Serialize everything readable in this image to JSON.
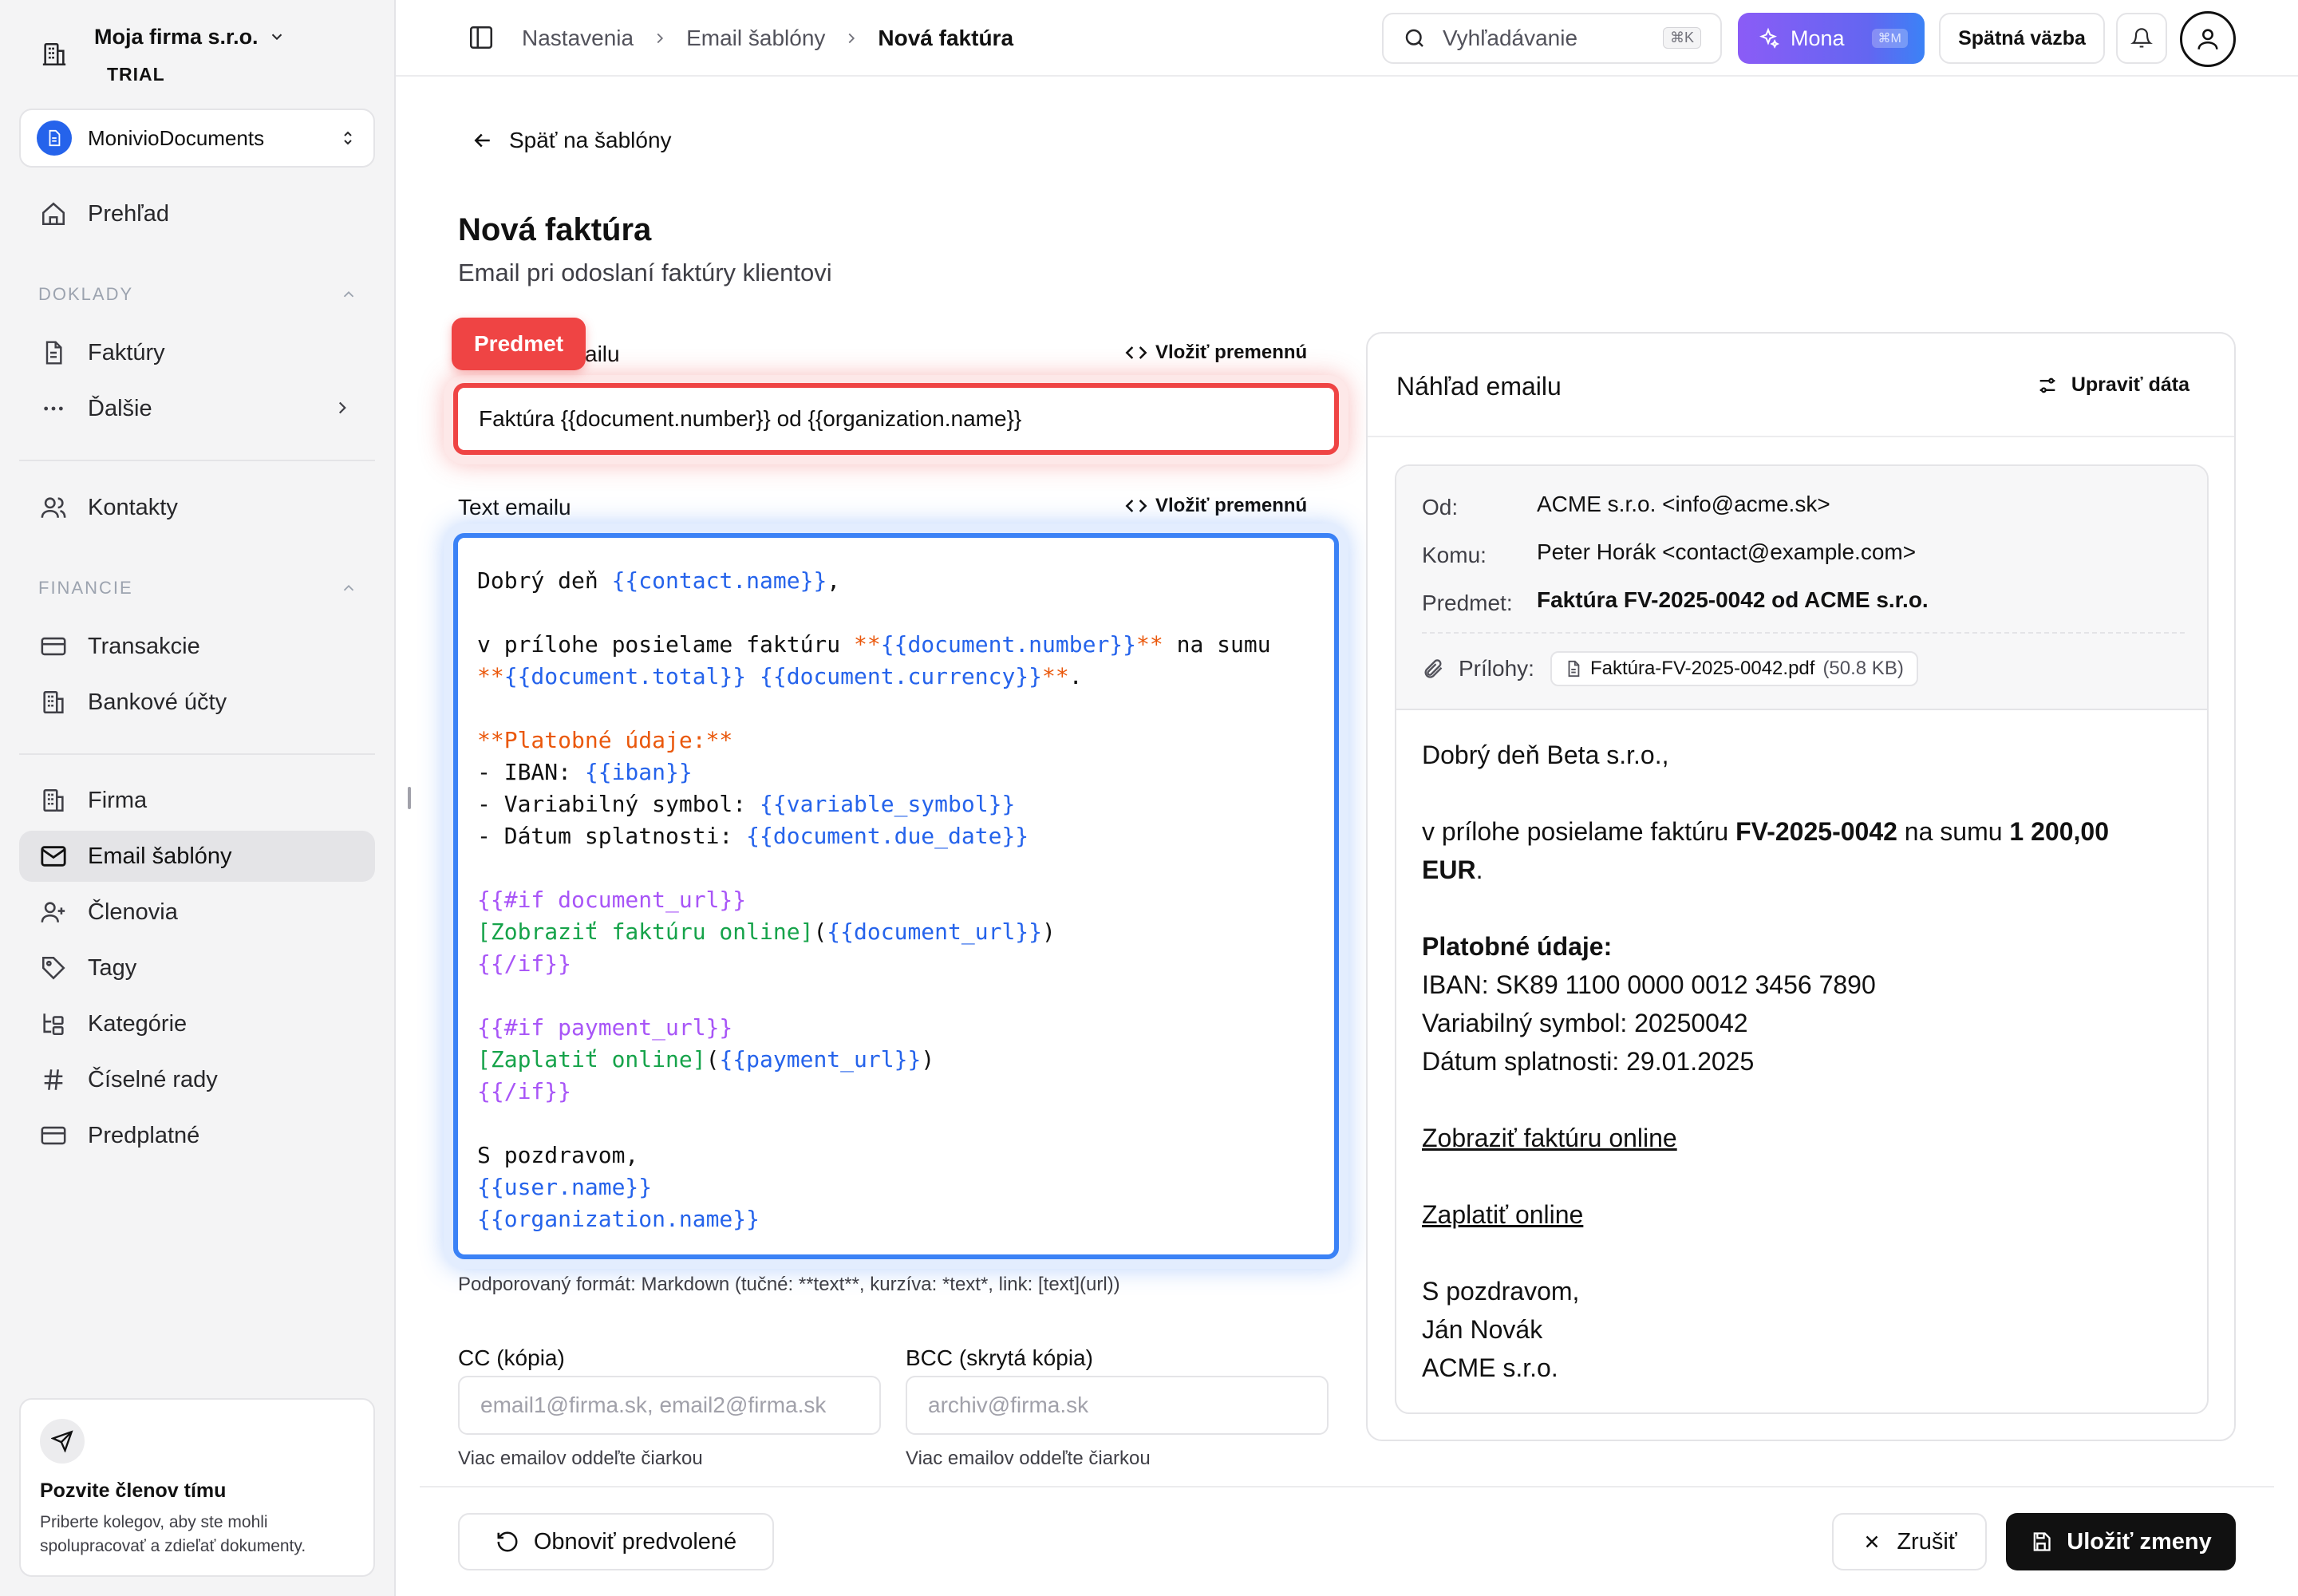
{
  "sidebar": {
    "org_name": "Moja firma s.r.o.",
    "org_badge": "TRIAL",
    "workspace": "MonivioDocuments",
    "items": {
      "overview": "Prehľad",
      "invoices": "Faktúry",
      "more": "Ďalšie",
      "contacts": "Kontakty",
      "transactions": "Transakcie",
      "bank_accounts": "Bankové účty",
      "company": "Firma",
      "email_templates": "Email šablóny",
      "members": "Členovia",
      "tags": "Tagy",
      "categories": "Kategórie",
      "number_series": "Číselné rady",
      "subscription": "Predplatné"
    },
    "sections": {
      "documents": "DOKLADY",
      "finance": "FINANCIE"
    },
    "invite": {
      "title": "Pozvite členov tímu",
      "text_line1": "Priberte kolegov, aby ste mohli",
      "text_line2": "spolupracovať a zdieľať dokumenty."
    }
  },
  "header": {
    "breadcrumbs": [
      "Nastavenia",
      "Email šablóny",
      "Nová faktúra"
    ],
    "search_placeholder": "Vyhľadávanie",
    "search_shortcut": "⌘K",
    "mona_label": "Mona",
    "mona_shortcut": "⌘M",
    "feedback_label": "Spätná väzba"
  },
  "main": {
    "back_label": "Späť na šablóny",
    "title": "Nová faktúra",
    "subtitle": "Email pri odoslaní faktúry klientovi",
    "subject": {
      "tag": "Predmet",
      "label_visible": "ailu",
      "insert_variable": "Vložiť premennú",
      "value": "Faktúra {{document.number}} od {{organization.name}}"
    },
    "body": {
      "label": "Text emailu",
      "insert_variable": "Vložiť premennú",
      "hint": "Podporovaný formát: Markdown (tučné: **text**, kurzíva: *text*, link: [text](url))"
    },
    "cc": {
      "label": "CC (kópia)",
      "placeholder": "email1@firma.sk, email2@firma.sk",
      "hint": "Viac emailov oddeľte čiarkou"
    },
    "bcc": {
      "label": "BCC (skrytá kópia)",
      "placeholder": "archiv@firma.sk",
      "hint": "Viac emailov oddeľte čiarkou"
    }
  },
  "footer": {
    "reset_label": "Obnoviť predvolené",
    "cancel_label": "Zrušiť",
    "save_label": "Uložiť zmeny"
  },
  "preview": {
    "title": "Náhľad emailu",
    "edit_data_label": "Upraviť dáta",
    "from_label": "Od:",
    "from_value": "ACME s.r.o. <info@acme.sk>",
    "to_label": "Komu:",
    "to_value": "Peter Horák <contact@example.com>",
    "subject_label": "Predmet:",
    "subject_value": "Faktúra FV-2025-0042 od ACME s.r.o.",
    "attachments_label": "Prílohy:",
    "attachment_name": "Faktúra-FV-2025-0042.pdf",
    "attachment_size": "(50.8 KB)",
    "greeting": "Dobrý deň Beta s.r.o.,",
    "line1_pre": "v prílohe posielame faktúru ",
    "line1_number": "FV-2025-0042",
    "line1_mid": " na sumu ",
    "line1_amount": "1 200,00",
    "line1_currency": "EUR",
    "line1_end": ".",
    "payment_heading": "Platobné údaje:",
    "iban": "IBAN: SK89 1100 0000 0012 3456 7890",
    "variable_symbol": "Variabilný symbol: 20250042",
    "due_date": "Dátum splatnosti: 29.01.2025",
    "view_online": "Zobraziť faktúru online",
    "pay_online": "Zaplatiť online",
    "closing": "S pozdravom,",
    "signature_name": "Ján Novák",
    "signature_org": "ACME s.r.o."
  },
  "colors": {
    "subject_highlight": "#ef4444",
    "body_highlight": "#3b82f6",
    "variable": "#2563eb",
    "bold_marker": "#ea580c",
    "block_keyword": "#a855f7",
    "link_text": "#16a34a",
    "workspace_icon": "#2563eb"
  }
}
